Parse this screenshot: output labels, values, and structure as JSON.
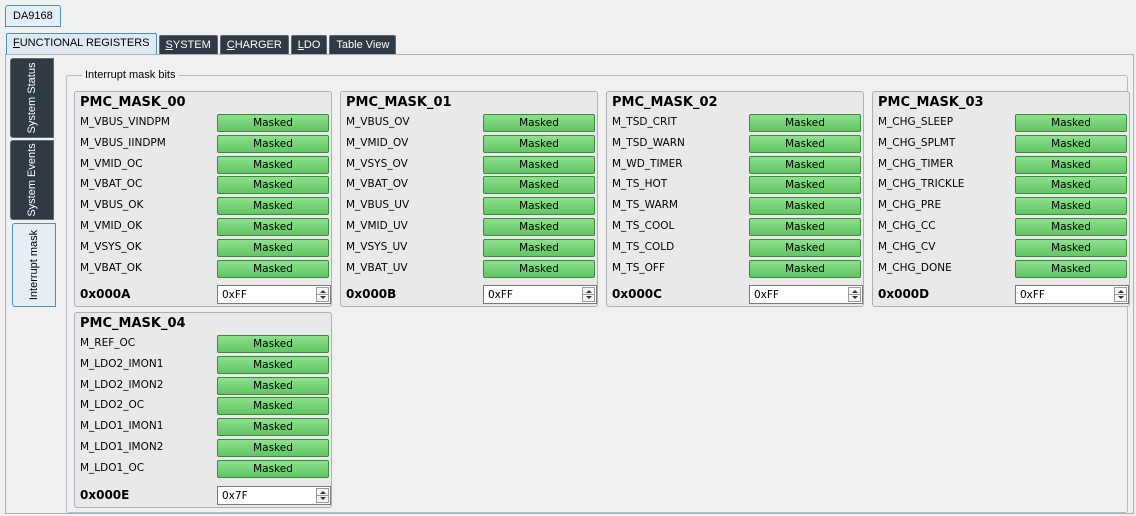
{
  "device": {
    "name": "DA9168"
  },
  "top_tabs": [
    {
      "label_ul": "F",
      "label_rest": "UNCTIONAL REGISTERS",
      "active": true
    },
    {
      "label_ul": "S",
      "label_rest": "YSTEM",
      "active": false
    },
    {
      "label_ul": "C",
      "label_rest": "HARGER",
      "active": false
    },
    {
      "label_ul": "L",
      "label_rest": "DO",
      "active": false
    },
    {
      "label_ul": "",
      "label_rest": "Table View",
      "active": false
    }
  ],
  "side_tabs": [
    {
      "label": "System Status",
      "active": false
    },
    {
      "label": "System Events",
      "active": false
    },
    {
      "label": "Interrupt mask",
      "active": true
    }
  ],
  "group": {
    "title": "Interrupt mask bits"
  },
  "panels": [
    {
      "title": "PMC_MASK_00",
      "rows": [
        {
          "label": "M_VBUS_VINDPM",
          "value": "Masked"
        },
        {
          "label": "M_VBUS_IINDPM",
          "value": "Masked"
        },
        {
          "label": "M_VMID_OC",
          "value": "Masked"
        },
        {
          "label": "M_VBAT_OC",
          "value": "Masked"
        },
        {
          "label": "M_VBUS_OK",
          "value": "Masked"
        },
        {
          "label": "M_VMID_OK",
          "value": "Masked"
        },
        {
          "label": "M_VSYS_OK",
          "value": "Masked"
        },
        {
          "label": "M_VBAT_OK",
          "value": "Masked"
        }
      ],
      "address": "0x000A",
      "hex_value": "0xFF"
    },
    {
      "title": "PMC_MASK_01",
      "rows": [
        {
          "label": "M_VBUS_OV",
          "value": "Masked"
        },
        {
          "label": "M_VMID_OV",
          "value": "Masked"
        },
        {
          "label": "M_VSYS_OV",
          "value": "Masked"
        },
        {
          "label": "M_VBAT_OV",
          "value": "Masked"
        },
        {
          "label": "M_VBUS_UV",
          "value": "Masked"
        },
        {
          "label": "M_VMID_UV",
          "value": "Masked"
        },
        {
          "label": "M_VSYS_UV",
          "value": "Masked"
        },
        {
          "label": "M_VBAT_UV",
          "value": "Masked"
        }
      ],
      "address": "0x000B",
      "hex_value": "0xFF"
    },
    {
      "title": "PMC_MASK_02",
      "rows": [
        {
          "label": "M_TSD_CRIT",
          "value": "Masked"
        },
        {
          "label": "M_TSD_WARN",
          "value": "Masked"
        },
        {
          "label": "M_WD_TIMER",
          "value": "Masked"
        },
        {
          "label": "M_TS_HOT",
          "value": "Masked"
        },
        {
          "label": "M_TS_WARM",
          "value": "Masked"
        },
        {
          "label": "M_TS_COOL",
          "value": "Masked"
        },
        {
          "label": "M_TS_COLD",
          "value": "Masked"
        },
        {
          "label": "M_TS_OFF",
          "value": "Masked"
        }
      ],
      "address": "0x000C",
      "hex_value": "0xFF"
    },
    {
      "title": "PMC_MASK_03",
      "rows": [
        {
          "label": "M_CHG_SLEEP",
          "value": "Masked"
        },
        {
          "label": "M_CHG_SPLMT",
          "value": "Masked"
        },
        {
          "label": "M_CHG_TIMER",
          "value": "Masked"
        },
        {
          "label": "M_CHG_TRICKLE",
          "value": "Masked"
        },
        {
          "label": "M_CHG_PRE",
          "value": "Masked"
        },
        {
          "label": "M_CHG_CC",
          "value": "Masked"
        },
        {
          "label": "M_CHG_CV",
          "value": "Masked"
        },
        {
          "label": "M_CHG_DONE",
          "value": "Masked"
        }
      ],
      "address": "0x000D",
      "hex_value": "0xFF"
    },
    {
      "title": "PMC_MASK_04",
      "rows": [
        {
          "label": "M_REF_OC",
          "value": "Masked"
        },
        {
          "label": "M_LDO2_IMON1",
          "value": "Masked"
        },
        {
          "label": "M_LDO2_IMON2",
          "value": "Masked"
        },
        {
          "label": "M_LDO2_OC",
          "value": "Masked"
        },
        {
          "label": "M_LDO1_IMON1",
          "value": "Masked"
        },
        {
          "label": "M_LDO1_IMON2",
          "value": "Masked"
        },
        {
          "label": "M_LDO1_OC",
          "value": "Masked"
        }
      ],
      "address": "0x000E",
      "hex_value": "0x7F"
    }
  ]
}
